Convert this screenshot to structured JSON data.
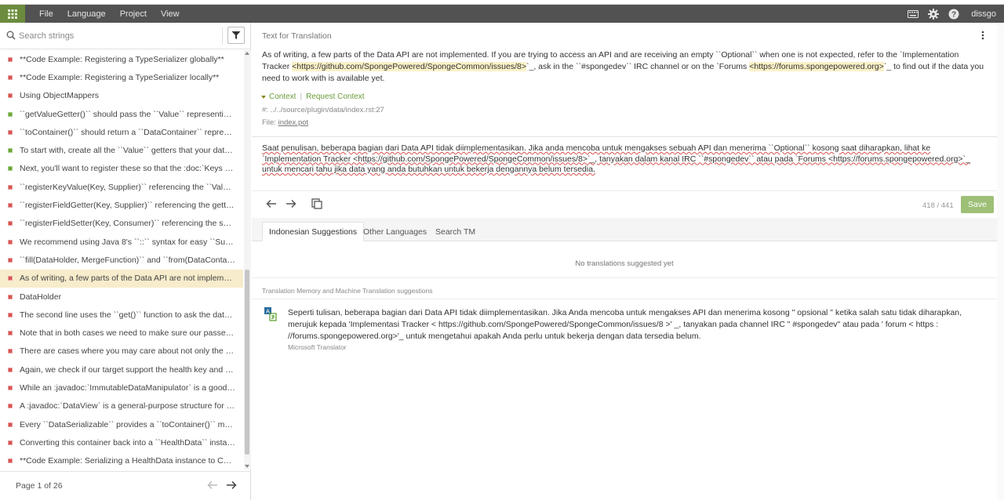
{
  "menubar": {
    "items": [
      "File",
      "Language",
      "Project",
      "View"
    ],
    "user": "dissgo",
    "icons": [
      "keyboard-icon",
      "gear-icon",
      "help-icon"
    ]
  },
  "sidebar": {
    "search_placeholder": "Search strings",
    "items": [
      {
        "status": "red",
        "text": "**Code Example: Registering a TypeSerializer globally**"
      },
      {
        "status": "red",
        "text": "**Code Example: Registering a TypeSerializer locally**"
      },
      {
        "status": "red",
        "text": "Using ObjectMappers"
      },
      {
        "status": "green",
        "text": "``getValueGetter()`` should pass the ``Value`` representing you..."
      },
      {
        "status": "red",
        "text": "``toContainer()`` should return a ``DataContainer`` representin..."
      },
      {
        "status": "green",
        "text": "To start with, create all the ``Value`` getters that your data will h..."
      },
      {
        "status": "green",
        "text": "Next, you'll want to register these so that the :doc:`Keys <../keys>..."
      },
      {
        "status": "red",
        "text": "``registerKeyValue(Key, Supplier)`` referencing the ``Value`` ge..."
      },
      {
        "status": "red",
        "text": "``registerFieldGetter(Key, Supplier)`` referencing the getter meth..."
      },
      {
        "status": "red",
        "text": "``registerFieldSetter(Key, Consumer)`` referencing the setter met..."
      },
      {
        "status": "red",
        "text": "We recommend using Java 8's ``::`` syntax for easy ``Supplier`` ..."
      },
      {
        "status": "red",
        "text": "``fill(DataHolder, MergeFunction)`` and ``from(DataContainer)``..."
      },
      {
        "status": "red",
        "text": "As of writing, a few parts of the Data API are not implemented. If y...",
        "active": true
      },
      {
        "status": "red",
        "text": "DataHolder"
      },
      {
        "status": "red",
        "text": "The second line uses the ``get()`` function to ask the data holder ..."
      },
      {
        "status": "red",
        "text": "Note that in both cases we need to make sure our passed function..."
      },
      {
        "status": "red",
        "text": "There are cases where you may care about not only the direct valu..."
      },
      {
        "status": "red",
        "text": "Again, we check if our target support the health key and then obta..."
      },
      {
        "status": "red",
        "text": "While an :javadoc:`ImmutableDataManipulator` is a good way to ..."
      },
      {
        "status": "red",
        "text": "A :javadoc:`DataView` is a general-purpose structure for holding ..."
      },
      {
        "status": "red",
        "text": "Every ``DataSerializable`` provides a ``toContainer()`` method ..."
      },
      {
        "status": "red",
        "text": "Converting this container back into a ``HealthData`` instance is d..."
      },
      {
        "status": "red",
        "text": "**Code Example: Serializing a HealthData instance to Configurate**"
      }
    ],
    "pager": "Page 1 of 26"
  },
  "editor": {
    "section_title": "Text for Translation",
    "source": {
      "part1": "As of writing, a few parts of the Data API are not implemented. If you are trying to access an API and are receiving an empty ``Optional`` when one is not expected, refer to the `Implementation Tracker ",
      "link1": "<https://github.com/SpongePowered/SpongeCommon/issues/8>",
      "part2": "`_, ask in the ``#spongedev`` IRC channel or on the `Forums ",
      "link2": "<https://forums.spongepowered.org>",
      "part3": "`_ to find out if the data you need to work with is available yet."
    },
    "context_label": "Context",
    "request_context": "Request Context",
    "path": "#: ../../source/plugin/data/index.rst:27",
    "file_label": "File:",
    "file_name": "index.pot",
    "translation": "Saat penulisan, beberapa bagian dari Data API tidak diimplementasikan. Jika anda mencoba untuk mengakses sebuah API dan menerima ``Optional`` kosong saat diharapkan, lihat ke `Implementation Tracker <https://github.com/SpongePowered/SpongeCommon/issues/8>`_, tanyakan dalam kanal IRC ``#spongedev`` atau pada `Forums <https://forums.spongepowered.org>`_ untuk mencari tahu jika data yang anda butuhkan untuk bekerja dengannya belum tersedia.",
    "counter": "418 / 441",
    "save_label": "Save"
  },
  "suggestions": {
    "tabs": [
      "Indonesian Suggestions",
      "Other Languages",
      "Search TM"
    ],
    "empty_text": "No translations suggested yet",
    "tm_title": "Translation Memory and Machine Translation suggestions",
    "mt_text": "Seperti tulisan, beberapa bagian dari Data API tidak diimplementasikan. Jika Anda mencoba untuk mengakses API dan menerima kosong \" opsional \" ketika salah satu tidak diharapkan, merujuk kepada 'Implementasi Tracker < https://github.com/SpongePowered/SpongeCommon/issues/8 >' _, tanyakan pada channel IRC \" #spongedev\" atau pada ' forum < https : //forums.spongepowered.org>'_ untuk mengetahui apakah Anda perlu untuk bekerja dengan data tersedia belum.",
    "mt_source": "Microsoft Translator"
  }
}
